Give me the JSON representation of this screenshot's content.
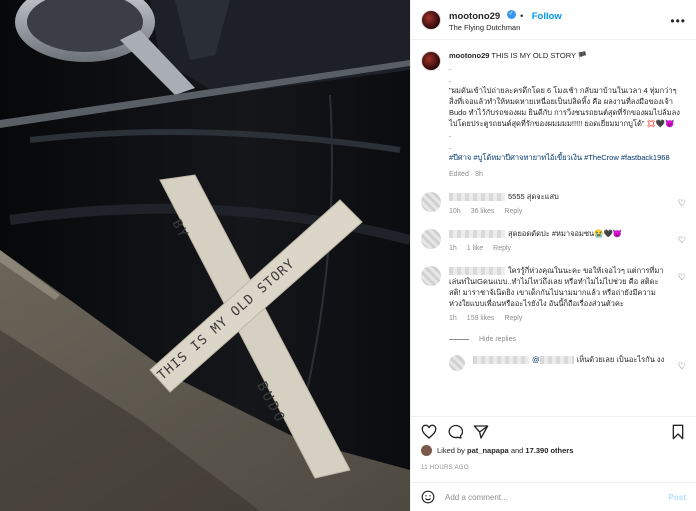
{
  "post": {
    "username": "mootono29",
    "follow_label": "Follow",
    "location": "The Flying Dutchman",
    "more_label": "•••",
    "caption_head": "THIS IS MY OLD STORY 🏴",
    "caption_dots": ".",
    "caption_body": "\"ผมดันเข้าไปถ่ายละครดึกโดย 6 โมงเช้า กลับมาบ้านในเวลา 4 ทุ่มกว่าๆ สิ่งที่เจอแล้วทำให้หมดหายเหนื่อยเป็นปลิดทิ้ง คือ ผลงานที่ลงมือของเจ้า Budo ทำไว้กับรถของผม ยินดีกับ การวิ่งชนรถยนต์สุดที่รักของผมไปล้มลงไปโดยประตูรถยนต์สุดที่รักของผมมมม!!!!! ยอดเยี่ยมมากบูโด้\" 💢🖤😈",
    "hashtags": "#ปีศาจ #บูโด้หมาปีศาจทายาทไอ้เขี้ยวเงิน #TheCrow #fastback1968",
    "edited": "Edited · 8h",
    "photo_text": {
      "by": "BY",
      "story": "THIS IS MY OLD STORY",
      "budo": "BUDO"
    }
  },
  "comments": [
    {
      "text": "5555 สุดจะแสบ",
      "age": "10h",
      "likes": "36 likes",
      "reply": "Reply"
    },
    {
      "text": "สุดยอดดัดปะ #หมาจอมซน😭🖤😈",
      "age": "1h",
      "likes": "1 like",
      "reply": "Reply"
    },
    {
      "text": "ใครรู้กี่ห่วงคุณในนะคะ ขอให้เจอไวๆ แต่การที่มาเล่นท่ในIGคนแบบ..ทำไม่ไหว่ถึงเลย หรือทำไมไม่ไปช่วย คือ สติดะ สติ! มาราชาจ้เนิดยิง เขาเด็กกันไปนามมากแล้ว หรือถ่ายังมีความห่วงใยแบบเพื่อนหรืออะไรยังไง อันนี้ก็ถือเรื่องส่วนตัวคะ",
      "age": "1h",
      "likes": "159 likes",
      "reply": "Reply"
    }
  ],
  "hide_replies": "Hide replies",
  "reply_comment": {
    "mention": "@",
    "text": "เห็นด้วยเลย เป็นอะไรกัน งง"
  },
  "likes_line": {
    "prefix": "Liked by",
    "user": "pat_napapa",
    "and": "and",
    "count": "17.390 others"
  },
  "timestamp": "11 HOURS AGO",
  "add_comment": {
    "placeholder": "Add a comment...",
    "post_label": "Post"
  }
}
